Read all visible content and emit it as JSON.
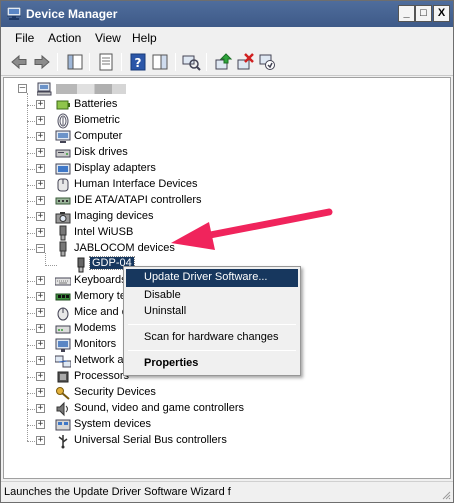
{
  "window": {
    "title": "Device Manager"
  },
  "title_buttons": {
    "minimize": "_",
    "maximize": "□",
    "close": "X"
  },
  "menubar": {
    "file": "File",
    "action": "Action",
    "view": "View",
    "help": "Help"
  },
  "tree": {
    "root_label": "",
    "categories": [
      {
        "label": "Batteries",
        "icon": "battery-icon"
      },
      {
        "label": "Biometric",
        "icon": "fingerprint-icon"
      },
      {
        "label": "Computer",
        "icon": "computer-icon"
      },
      {
        "label": "Disk drives",
        "icon": "disk-drive-icon"
      },
      {
        "label": "Display adapters",
        "icon": "display-adapter-icon"
      },
      {
        "label": "Human Interface Devices",
        "icon": "hid-icon"
      },
      {
        "label": "IDE ATA/ATAPI controllers",
        "icon": "ide-controller-icon"
      },
      {
        "label": "Imaging devices",
        "icon": "camera-icon"
      },
      {
        "label": "Intel WiUSB",
        "icon": "usb-device-icon"
      },
      {
        "label": "JABLOCOM devices",
        "icon": "usb-device-icon"
      },
      {
        "label": "GDP-04",
        "icon": "usb-plug-icon"
      },
      {
        "label": "Keyboards",
        "icon": "keyboard-icon"
      },
      {
        "label": "Memory tec",
        "icon": "memory-icon"
      },
      {
        "label": "Mice and ot",
        "icon": "mouse-icon"
      },
      {
        "label": "Modems",
        "icon": "modem-icon"
      },
      {
        "label": "Monitors",
        "icon": "monitor-icon"
      },
      {
        "label": "Network ac",
        "icon": "network-icon"
      },
      {
        "label": "Processors",
        "icon": "processor-icon"
      },
      {
        "label": "Security Devices",
        "icon": "security-key-icon"
      },
      {
        "label": "Sound, video and game controllers",
        "icon": "sound-icon"
      },
      {
        "label": "System devices",
        "icon": "system-device-icon"
      },
      {
        "label": "Universal Serial Bus controllers",
        "icon": "usb-controller-icon"
      }
    ]
  },
  "context_menu": {
    "update": "Update Driver Software...",
    "disable": "Disable",
    "uninstall": "Uninstall",
    "scan": "Scan for hardware changes",
    "properties": "Properties"
  },
  "status": {
    "text": "Launches the Update Driver Software Wizard f"
  },
  "colors": {
    "arrow": "#f0245c",
    "selection": "#17375e",
    "titlebar": "#4a6898"
  }
}
